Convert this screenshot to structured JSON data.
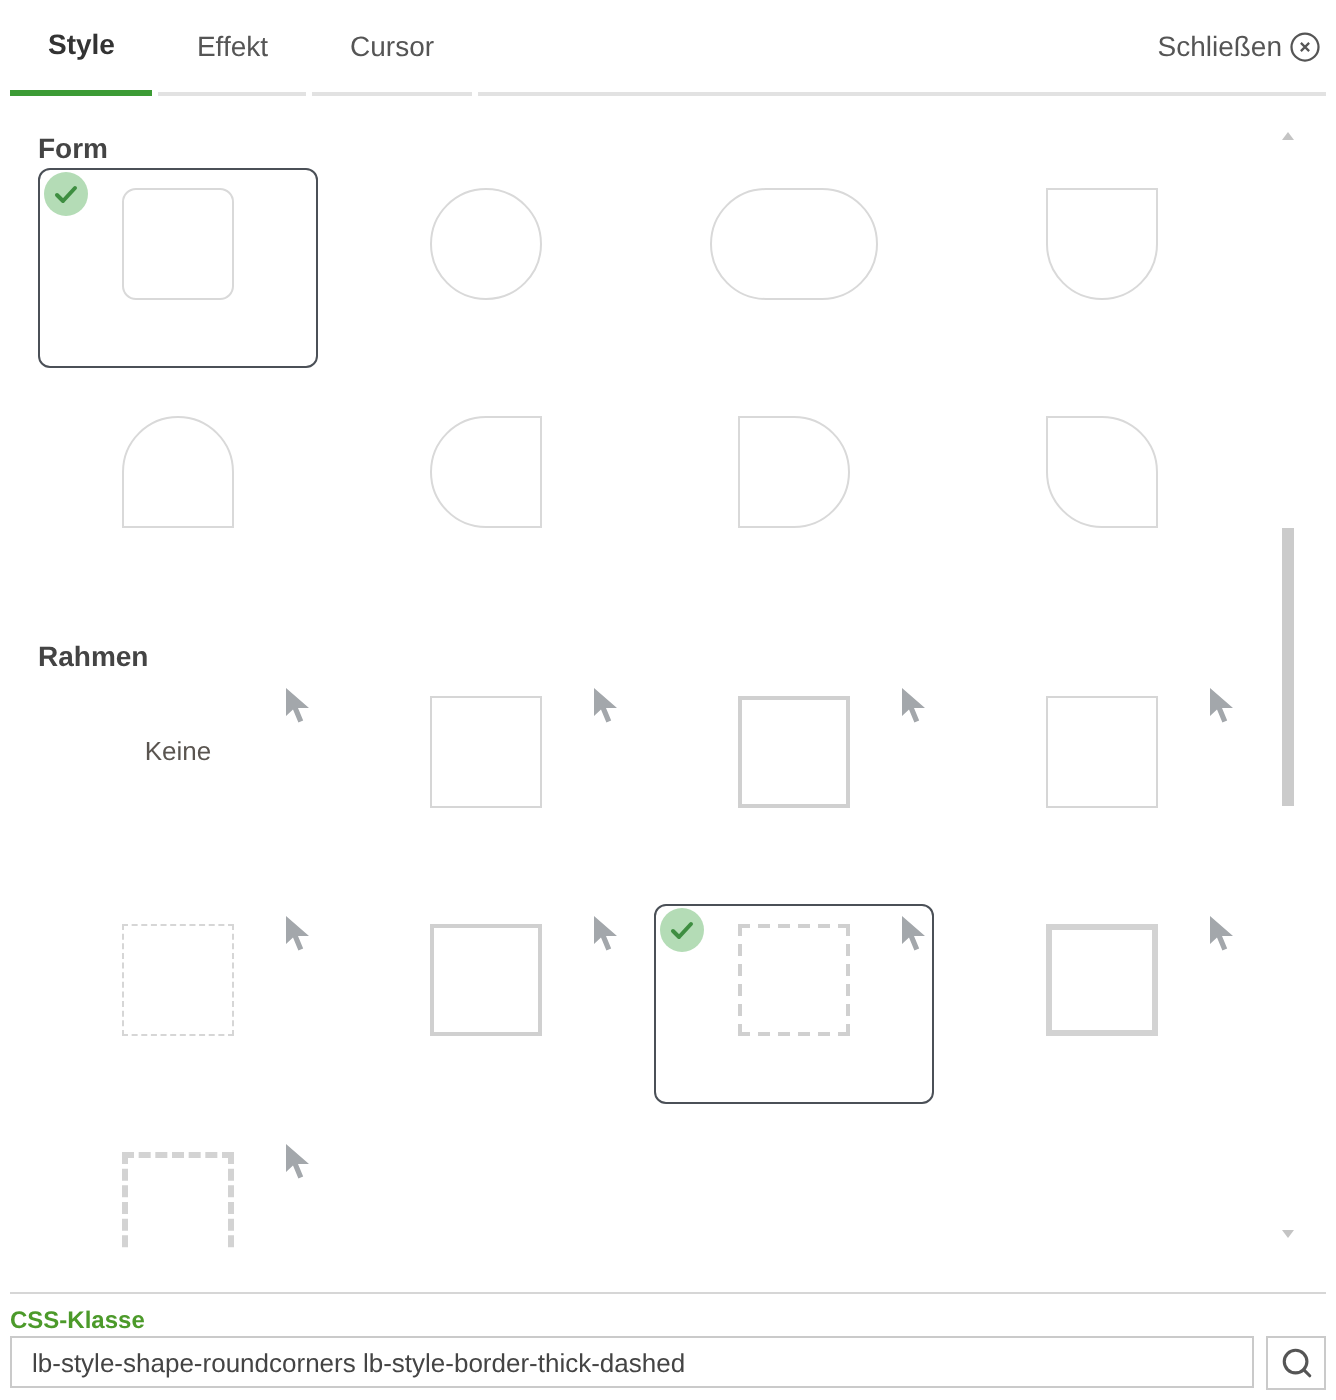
{
  "tabs": [
    {
      "label": "Style",
      "selected": true
    },
    {
      "label": "Effekt",
      "selected": false
    },
    {
      "label": "Cursor",
      "selected": false
    }
  ],
  "close_button": {
    "label": "Schließen"
  },
  "sections": [
    {
      "title": "Form",
      "kind": "shape",
      "options": [
        {
          "kind": "roundcorners",
          "selected": true
        },
        {
          "kind": "circle",
          "selected": false
        },
        {
          "kind": "pill",
          "selected": false
        },
        {
          "kind": "roundbottom",
          "selected": false
        },
        {
          "kind": "roundtop",
          "selected": false
        },
        {
          "kind": "roundleft",
          "selected": false
        },
        {
          "kind": "roundright",
          "selected": false
        },
        {
          "kind": "leaf",
          "selected": false
        }
      ]
    },
    {
      "title": "Rahmen",
      "kind": "border",
      "options": [
        {
          "kind": "none",
          "label": "Keine",
          "selected": false
        },
        {
          "kind": "thin",
          "selected": false
        },
        {
          "kind": "thick",
          "selected": false
        },
        {
          "kind": "thin",
          "selected": false
        },
        {
          "kind": "thindashed",
          "selected": false
        },
        {
          "kind": "thick",
          "selected": false
        },
        {
          "kind": "thickdashed",
          "selected": true
        },
        {
          "kind": "heavy",
          "selected": false
        },
        {
          "kind": "heavydashed",
          "selected": false
        }
      ]
    }
  ],
  "css_class": {
    "label": "CSS-Klasse",
    "value": "lb-style-shape-roundcorners lb-style-border-thick-dashed"
  }
}
